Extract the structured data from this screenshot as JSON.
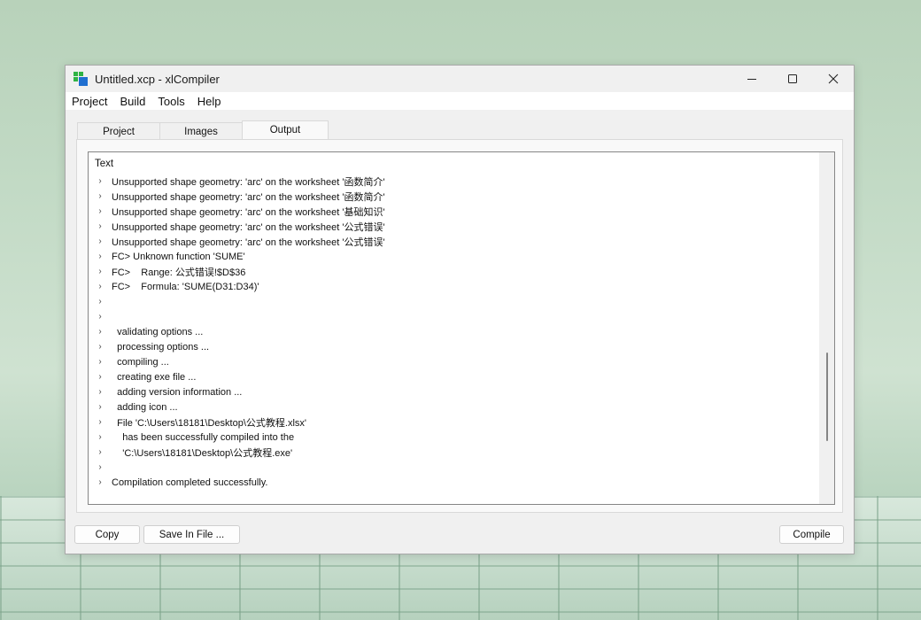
{
  "window": {
    "title": "Untitled.xcp - xlCompiler",
    "icon": "app-grid-icon",
    "controls": {
      "minimize": "minimize-icon",
      "maximize": "maximize-icon",
      "close": "close-icon"
    }
  },
  "menubar": {
    "items": [
      {
        "label": "Project"
      },
      {
        "label": "Build"
      },
      {
        "label": "Tools"
      },
      {
        "label": "Help"
      }
    ]
  },
  "tabs": [
    {
      "label": "Project",
      "active": false
    },
    {
      "label": "Images",
      "active": false
    },
    {
      "label": "Output",
      "active": true
    }
  ],
  "output": {
    "column_header": "Text",
    "lines": [
      "Unsupported shape geometry: 'arc' on the worksheet '函数简介'",
      "Unsupported shape geometry: 'arc' on the worksheet '函数简介'",
      "Unsupported shape geometry: 'arc' on the worksheet '基础知识'",
      "Unsupported shape geometry: 'arc' on the worksheet '公式错误'",
      "Unsupported shape geometry: 'arc' on the worksheet '公式错误'",
      "FC> Unknown function 'SUME'",
      "FC>    Range: 公式错误!$D$36",
      "FC>    Formula: 'SUME(D31:D34)'",
      "",
      "",
      "  validating options ...",
      "  processing options ...",
      "  compiling ...",
      "  creating exe file ...",
      "  adding version information ...",
      "  adding icon ...",
      "  File 'C:\\Users\\18181\\Desktop\\公式教程.xlsx'",
      "    has been successfully compiled into the",
      "    'C:\\Users\\18181\\Desktop\\公式教程.exe'",
      "",
      "Compilation completed successfully."
    ],
    "scroll_position": 0.78
  },
  "buttons": {
    "copy": "Copy",
    "save_in_file": "Save In File ...",
    "compile": "Compile"
  },
  "colors": {
    "icon_green": "#2fb344",
    "icon_blue": "#1f6fd0"
  }
}
